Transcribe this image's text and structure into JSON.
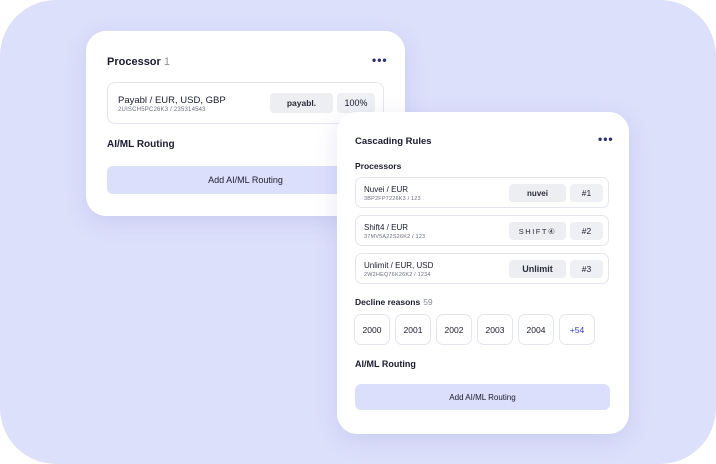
{
  "colors": {
    "background_panel": "#dde0fb",
    "card": "#ffffff",
    "button": "#dcdffb",
    "accent": "#2f3bd3"
  },
  "card1": {
    "title": "Processor",
    "count": "1",
    "menu_icon": "more-horizontal-icon",
    "processor": {
      "name": "Payabl / EUR, USD, GBP",
      "id": "2UISCH5PC26K3 / 235314543",
      "logo": "payabl.",
      "percent": "100%"
    },
    "section_title": "AI/ML Routing",
    "add_button": "Add AI/ML Routing"
  },
  "card2": {
    "title": "Cascading Rules",
    "menu_icon": "more-horizontal-icon",
    "processors_title": "Processors",
    "processors": [
      {
        "name": "Nuvei / EUR",
        "id": "3BP2FP7226K3 / 123",
        "logo": "nuvei",
        "rank": "#1"
      },
      {
        "name": "Shift4 / EUR",
        "id": "37MV5A22S26K2 / 123",
        "logo": "SHIFT④",
        "rank": "#2"
      },
      {
        "name": "Unlimit / EUR, USD",
        "id": "2W2HEQ76K26K2 / 1234",
        "logo": "Unlimit",
        "rank": "#3"
      }
    ],
    "decline_title": "Decline reasons",
    "decline_count": "59",
    "decline_codes": [
      "2000",
      "2001",
      "2002",
      "2003",
      "2004"
    ],
    "decline_more": "+54",
    "section_title": "AI/ML Routing",
    "add_button": "Add AI/ML Routing"
  }
}
